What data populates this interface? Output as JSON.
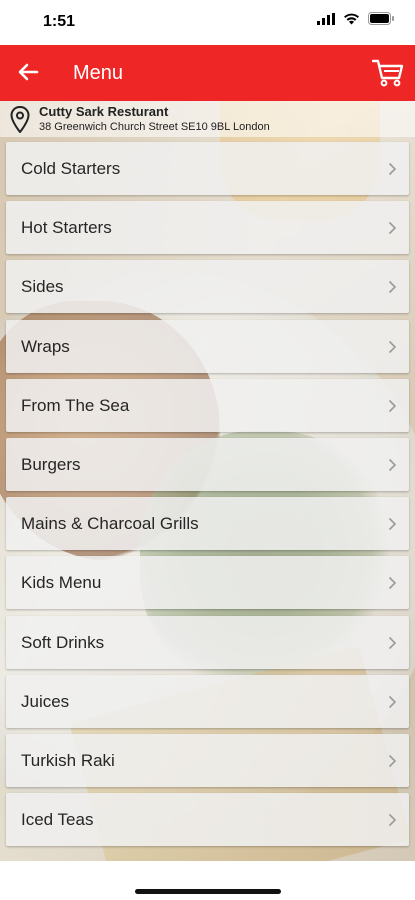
{
  "status_bar": {
    "time": "1:51"
  },
  "header": {
    "title": "Menu"
  },
  "location": {
    "name": "Cutty Sark Resturant",
    "address": "38 Greenwich Church Street SE10 9BL London"
  },
  "menu": {
    "items": [
      {
        "label": "Cold Starters"
      },
      {
        "label": "Hot Starters"
      },
      {
        "label": "Sides"
      },
      {
        "label": "Wraps"
      },
      {
        "label": "From The Sea"
      },
      {
        "label": "Burgers"
      },
      {
        "label": "Mains & Charcoal Grills"
      },
      {
        "label": "Kids Menu"
      },
      {
        "label": "Soft Drinks"
      },
      {
        "label": "Juices"
      },
      {
        "label": "Turkish Raki"
      },
      {
        "label": "Iced Teas"
      }
    ]
  },
  "colors": {
    "accent": "#ee2726"
  },
  "icons": {
    "back": "back-arrow-icon",
    "cart": "cart-icon",
    "pin": "location-pin-icon",
    "chevron": "chevron-right-icon"
  }
}
